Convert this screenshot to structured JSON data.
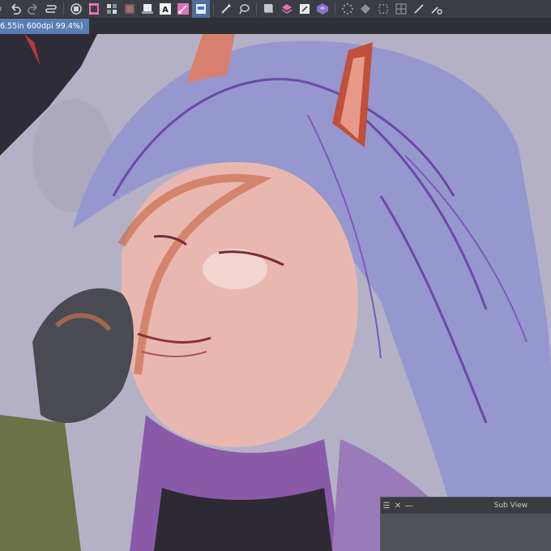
{
  "toolbar": {
    "icons": [
      "menu-edge-icon",
      "undo-icon",
      "redo-icon",
      "history-icon",
      "layer-fill-icon",
      "film-icon",
      "grid-icon",
      "ruler-icon",
      "copy-layer-icon",
      "text-layer-icon",
      "vector-icon",
      "select-layer-icon",
      "brush-tool-icon",
      "lasso-icon",
      "paste-icon",
      "layer-stack-icon",
      "new-raster-icon",
      "material-icon",
      "dots-icon",
      "transform-icon",
      "crop-icon",
      "mesh-icon",
      "pen-icon",
      "settings-icon"
    ]
  },
  "document_tab": {
    "label": "6.55in 600dpi 99.4%)"
  },
  "sub_view": {
    "menu_glyph": "☰",
    "close_glyph": "✕",
    "minimize_glyph": "—",
    "title": "Sub View"
  },
  "colors": {
    "toolbar_bg": "#3b3d44",
    "tab_active": "#5a7db4",
    "canvas_bg": "#b4b1c7",
    "hair": "#9a9ad0",
    "hair_dark": "#6a4aa8",
    "skin": "#e8b8b0",
    "ear": "#c0503a"
  }
}
